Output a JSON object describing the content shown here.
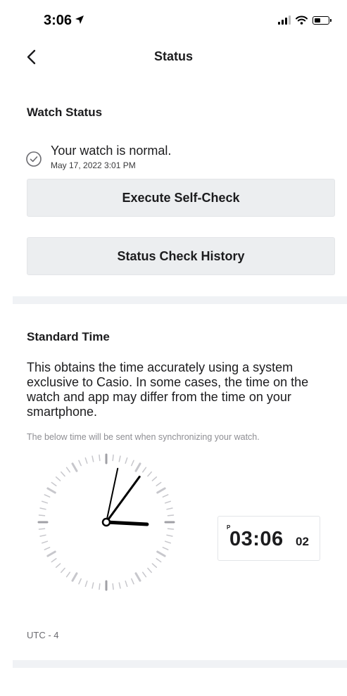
{
  "status_bar": {
    "time": "3:06"
  },
  "nav": {
    "title": "Status"
  },
  "watch_status": {
    "title": "Watch Status",
    "message": "Your watch is normal.",
    "date": "May 17, 2022 3:01 PM",
    "self_check_label": "Execute Self-Check",
    "history_label": "Status Check History"
  },
  "standard_time": {
    "title": "Standard Time",
    "description": "This obtains the time accurately using a system exclusive to Casio. In some cases, the time on the watch and app may differ from the time on your smartphone.",
    "sync_note": "The below time will be sent when synchronizing your watch.",
    "digital": {
      "ampm": "P",
      "hours_minutes": "03:06",
      "seconds": "02"
    },
    "utc_offset": "UTC - 4"
  },
  "colors": {
    "text": "#1c1c1e",
    "button_bg": "#eceef0",
    "divider": "#f0f2f5",
    "tick": "#c7c7cc"
  }
}
